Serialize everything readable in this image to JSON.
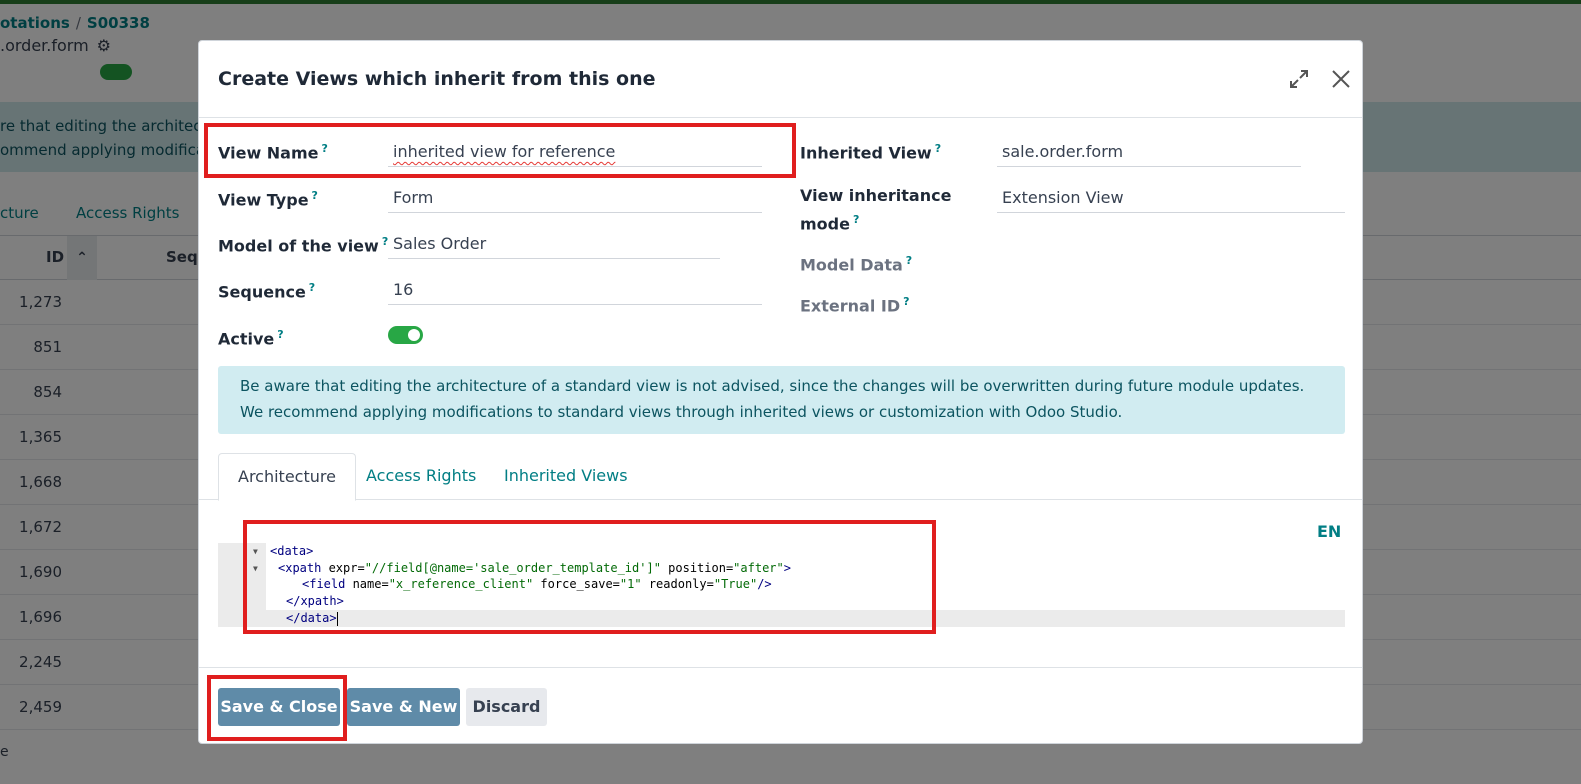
{
  "background": {
    "breadcrumb": {
      "parent": "otations",
      "current": "S00338"
    },
    "subtitle": ".order.form",
    "alert_lines": [
      "re that editing the architec",
      "ommend applying modifica"
    ],
    "tabs": [
      "cture",
      "Access Rights"
    ],
    "table_headers": {
      "id": "ID",
      "sequence": "Sequ"
    },
    "rows": [
      "1,273",
      "851",
      "854",
      "1,365",
      "1,668",
      "1,672",
      "1,690",
      "1,696",
      "2,245",
      "2,459"
    ],
    "footer_text": "e"
  },
  "modal": {
    "title": "Create Views which inherit from this one",
    "fields": {
      "view_name": {
        "label": "View Name",
        "help": "?",
        "value": "inherited view for reference"
      },
      "view_type": {
        "label": "View Type",
        "help": "?",
        "value": "Form"
      },
      "model": {
        "label": "Model of the view",
        "help": "?",
        "value": "Sales Order"
      },
      "sequence": {
        "label": "Sequence",
        "help": "?",
        "value": "16"
      },
      "active": {
        "label": "Active",
        "help": "?",
        "value": true
      },
      "inherited_view": {
        "label": "Inherited View",
        "help": "?",
        "value": "sale.order.form"
      },
      "inheritance_mode": {
        "label_line1": "View inheritance",
        "label_line2": "mode",
        "help": "?",
        "value": "Extension View"
      },
      "model_data": {
        "label": "Model Data",
        "help": "?"
      },
      "external_id": {
        "label": "External ID",
        "help": "?"
      }
    },
    "alert": {
      "line1": "Be aware that editing the architecture of a standard view is not advised, since the changes will be overwritten during future module updates.",
      "line2": "We recommend applying modifications to standard views through inherited views or customization with Odoo Studio."
    },
    "tabs": [
      "Architecture",
      "Access Rights",
      "Inherited Views"
    ],
    "active_tab": "Architecture",
    "lang": "EN",
    "code": {
      "l1": {
        "tag": "<data>"
      },
      "l2": {
        "open": "<xpath ",
        "a1": "expr=",
        "v1": "\"//field[@name='sale_order_template_id']\"",
        "a2": " position=",
        "v2": "\"after\"",
        "close": ">"
      },
      "l3": {
        "open": "<field ",
        "a1": "name=",
        "v1": "\"x_reference_client\"",
        "a2": " force_save=",
        "v2": "\"1\"",
        "a3": " readonly=",
        "v3": "\"True\"",
        "close": "/>"
      },
      "l4": {
        "tag": "</xpath>"
      },
      "l5": {
        "tag": "</data>"
      }
    },
    "buttons": {
      "save_close": "Save & Close",
      "save_new": "Save & New",
      "discard": "Discard"
    }
  },
  "colors": {
    "primary": "#5f8ba8",
    "link": "#017e84",
    "toggle": "#28a745",
    "annotation": "#e01e1e",
    "alert_bg": "#d1ecf1"
  }
}
